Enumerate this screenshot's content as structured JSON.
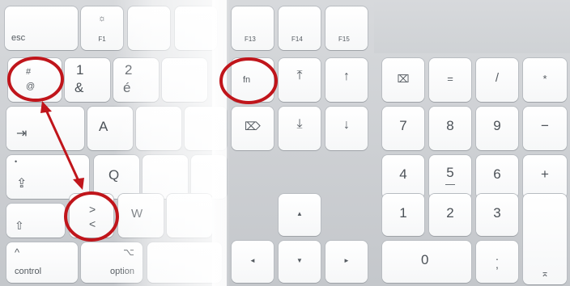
{
  "keys": {
    "esc": "esc",
    "f1": "F1",
    "f1_icon": "☼",
    "f13": "F13",
    "f14": "F14",
    "f15": "F15",
    "hash_top": "#",
    "hash_bottom": "@",
    "one_top": "1",
    "one_bottom": "&",
    "two_top": "2",
    "two_bottom": "é",
    "fn": "fn",
    "home": "⤒",
    "page_up": "↑",
    "clear": "⌧",
    "equals": "=",
    "slash": "/",
    "asterisk": "*",
    "tab": "⇥",
    "a": "A",
    "delete_fwd": "⌦",
    "end": "⤓",
    "page_down": "↓",
    "num7": "7",
    "num8": "8",
    "num9": "9",
    "minus": "−",
    "caps_dot": "•",
    "caps": "⇪",
    "q": "Q",
    "num4": "4",
    "num5": "5",
    "num6": "6",
    "plus": "+",
    "shift": "⇧",
    "gt": ">",
    "lt": "<",
    "w": "W",
    "arrow_up": "▲",
    "num1": "1",
    "num2": "2",
    "num3": "3",
    "control_icon": "^",
    "control": "control",
    "option_icon": "⌥",
    "option": "option",
    "arrow_left": "◄",
    "arrow_down": "▼",
    "arrow_right": "►",
    "num0": "0",
    "num_decimal_top": ".",
    "num_decimal_bottom": ",",
    "enter": "⌅"
  },
  "colors": {
    "annotation_red": "#c0151b"
  }
}
